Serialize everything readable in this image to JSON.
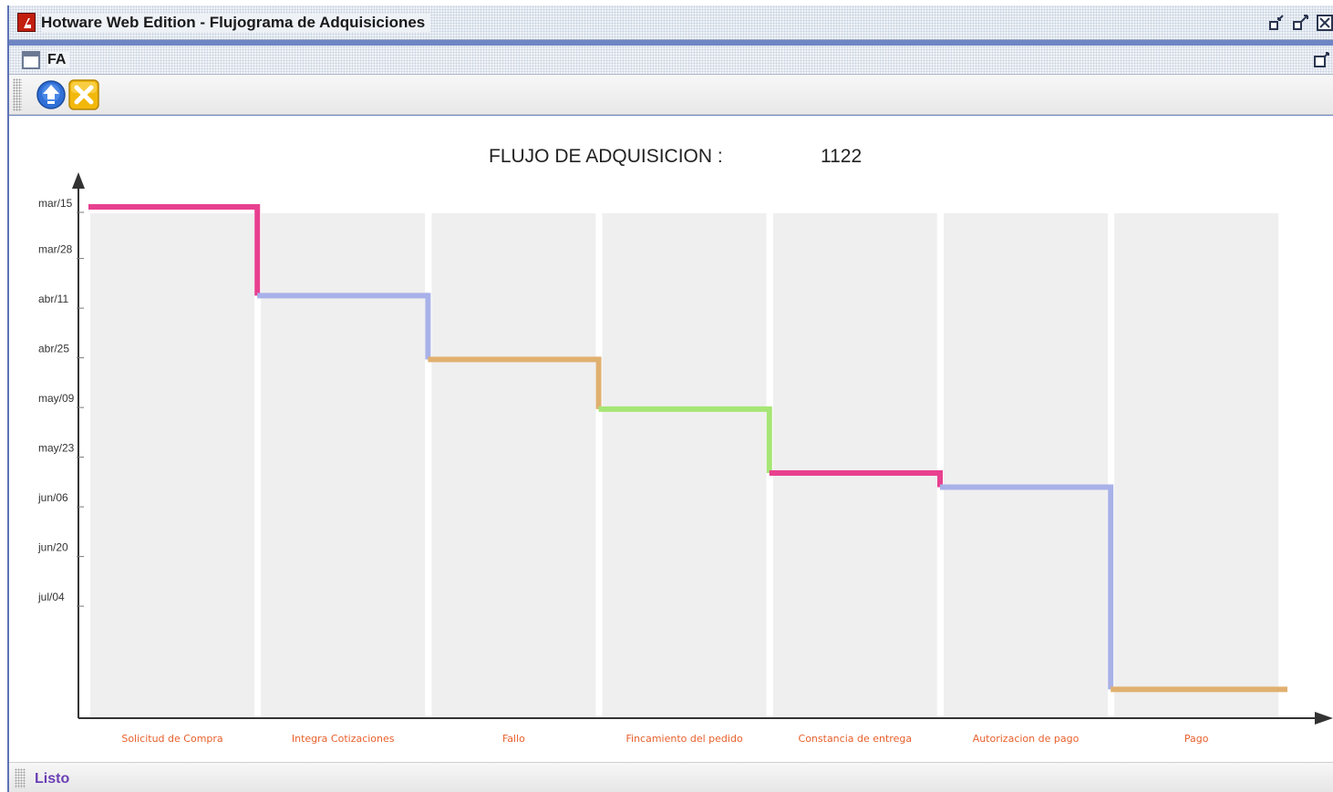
{
  "window": {
    "title": "Hotware Web Edition - Flujograma de Adquisiciones"
  },
  "frame": {
    "title": "FA"
  },
  "toolbar": {
    "icons": [
      "upload-arrow-icon",
      "close-x-icon"
    ]
  },
  "chart_header": {
    "label": "FLUJO DE ADQUISICION :",
    "number": "1122"
  },
  "status": {
    "text": "Listo"
  },
  "colors": {
    "pink": "#e8408f",
    "lavender": "#a8b1e8",
    "orange": "#e0b070",
    "green": "#a6e675",
    "stage_label": "#e8602c",
    "column_bg": "#efefef"
  },
  "chart_data": {
    "type": "line",
    "step": true,
    "y_tick_labels": [
      "mar/15",
      "mar/28",
      "abr/11",
      "abr/25",
      "may/09",
      "may/23",
      "jun/06",
      "jun/20",
      "jul/04"
    ],
    "y_axis_inverted": true,
    "categories": [
      "Solicitud de Compra",
      "Integra Cotizaciones",
      "Fallo",
      "Fincamiento del pedido",
      "Constancia de entrega",
      "Autorizacion de pago",
      "Pago"
    ],
    "segments": [
      {
        "stage": "Solicitud de Compra",
        "date": "mar/15",
        "color": "#e8408f"
      },
      {
        "stage": "Integra Cotizaciones",
        "date": "abr/09",
        "color": "#a8b1e8"
      },
      {
        "stage": "Fallo",
        "date": "abr/27",
        "color": "#e0b070"
      },
      {
        "stage": "Fincamiento del pedido",
        "date": "may/11",
        "color": "#a6e675"
      },
      {
        "stage": "Constancia de entrega",
        "date": "may/29",
        "color": "#e8408f"
      },
      {
        "stage": "Autorizacion de pago",
        "date": "jun/02",
        "color": "#a8b1e8"
      },
      {
        "stage": "Pago",
        "date": "jul/29",
        "color": "#e0b070"
      }
    ],
    "grid": false
  }
}
